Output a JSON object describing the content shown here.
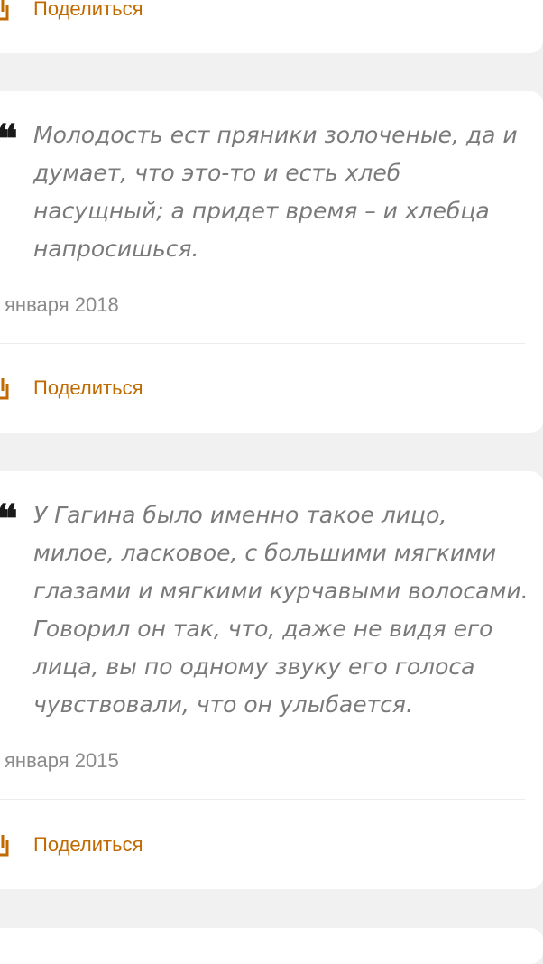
{
  "theme": {
    "background": "#f1f1f1",
    "card": "#ffffff",
    "accent": "#c06a00",
    "quote_text": "#7a7a7a",
    "date_text": "#8a8a8a"
  },
  "top_card": {
    "share_label": "Поделиться",
    "share_icon": "share-icon"
  },
  "quotes": [
    {
      "mark": "❝",
      "text": "Молодость ест пряники золоченые, да и думает, что это-то и есть хлеб насущный; а придет время – и хлебца напросишься.",
      "date": "января 2018",
      "share_label": "Поделиться",
      "share_icon": "share-icon"
    },
    {
      "mark": "❝",
      "text": "У Гагина было именно такое лицо, милое, ласковое, с большими мягкими глазами и мягкими курчавыми волосами. Говорил он так, что, даже не видя его лица, вы по одному звуку его голоса чувствовали, что он улыбается.",
      "date": "января 2015",
      "share_label": "Поделиться",
      "share_icon": "share-icon"
    }
  ]
}
